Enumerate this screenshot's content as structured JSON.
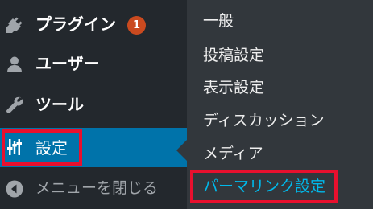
{
  "colors": {
    "menu_bg": "#23282d",
    "submenu_bg": "#32373c",
    "active_bg": "#0073aa",
    "badge_bg": "#ca4a1f",
    "highlight_outline": "#e8102e",
    "active_sub_text": "#00b9eb",
    "muted_text": "#a0a5aa"
  },
  "adminmenu": {
    "items": [
      {
        "label": "プラグイン",
        "icon": "plugin-icon",
        "badge": "1"
      },
      {
        "label": "ユーザー",
        "icon": "user-icon"
      },
      {
        "label": "ツール",
        "icon": "wrench-icon"
      },
      {
        "label": "設定",
        "icon": "settings-sliders-icon",
        "active": true
      },
      {
        "label": "メニューを閉じる",
        "icon": "collapse-arrow-icon"
      }
    ]
  },
  "submenu": {
    "items": [
      {
        "label": "一般"
      },
      {
        "label": "投稿設定"
      },
      {
        "label": "表示設定"
      },
      {
        "label": "ディスカッション"
      },
      {
        "label": "メディア"
      },
      {
        "label": "パーマリンク設定",
        "current": true
      }
    ]
  }
}
